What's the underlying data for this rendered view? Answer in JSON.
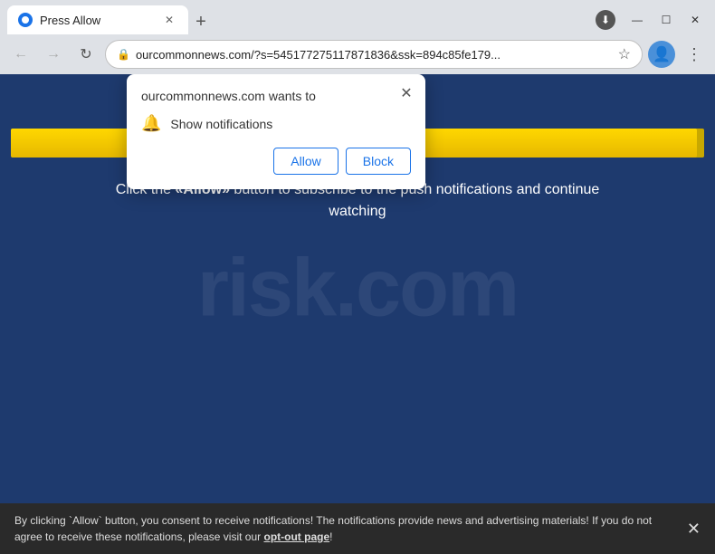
{
  "window": {
    "title": "Press Allow",
    "controls": {
      "minimize": "—",
      "maximize": "☐",
      "close": "✕"
    }
  },
  "tab": {
    "favicon_alt": "globe",
    "title": "Press Allow",
    "close": "✕"
  },
  "new_tab_btn": "+",
  "toolbar": {
    "back": "←",
    "forward": "→",
    "reload": "↻",
    "address": "ourcommonnews.com/?s=54517727 5117871836&ssk=894c85fe179...",
    "address_full": "ourcommonnews.com/?s=545177275117871836&ssk=894c85fe179...",
    "star": "☆",
    "profile_initial": "👤",
    "more": "⋮",
    "lock": "🔒"
  },
  "page": {
    "watermark": "risk.com",
    "progress_percent": "99%",
    "progress_width": "99",
    "cta_line1": "Click the «Allow» button to subscribe to the push notifications and continue",
    "cta_line2": "watching"
  },
  "dialog": {
    "site_text": "ourcommonnews.com wants to",
    "close": "✕",
    "permission_label": "Show notifications",
    "allow_btn": "Allow",
    "block_btn": "Block"
  },
  "bottom_bar": {
    "text_before": "By clicking `Allow` button, you consent to receive notifications! The notifications provide news and advertising materials! If you do not agree to receive these notifications, please visit our ",
    "link_text": "opt-out page",
    "text_after": "!",
    "close": "✕"
  },
  "colors": {
    "page_bg": "#1e3a6e",
    "progress_bg": "#ffd700",
    "tab_bg": "#ffffff",
    "chrome_bg": "#dee1e6",
    "dialog_bg": "#ffffff",
    "bottom_bar_bg": "#2a2a2a",
    "button_color": "#1a73e8"
  }
}
